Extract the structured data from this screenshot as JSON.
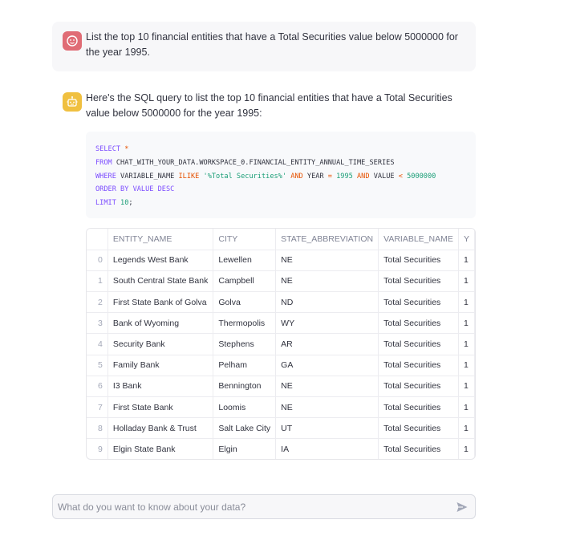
{
  "chat": {
    "user_message": "List the top 10 financial entities that have a Total Securities value below 5000000 for the year 1995.",
    "assistant_message": "Here's the SQL query to list the top 10 financial entities that have a Total Securities value below 5000000 for the year 1995:",
    "sql": {
      "line1_kw": "SELECT",
      "line1_rest": " *",
      "line2_kw": "FROM",
      "line2_rest": " CHAT_WITH_YOUR_DATA.WORKSPACE_0.FINANCIAL_ENTITY_ANNUAL_TIME_SERIES",
      "line3_kw": "WHERE",
      "line3_a": " VARIABLE_NAME ",
      "line3_ilike": "ILIKE",
      "line3_str": " '%Total Securities%' ",
      "line3_and1": "AND",
      "line3_b": " YEAR ",
      "line3_eq": "=",
      "line3_year": " 1995 ",
      "line3_and2": "AND",
      "line3_c": " VALUE ",
      "line3_lt": "<",
      "line3_val": " 5000000",
      "line4_kw": "ORDER BY",
      "line4_rest": " VALUE DESC",
      "line5_kw": "LIMIT",
      "line5_num": " 10",
      "line5_end": ";"
    }
  },
  "table": {
    "columns": [
      "",
      "ENTITY_NAME",
      "CITY",
      "STATE_ABBREVIATION",
      "VARIABLE_NAME",
      "Y"
    ],
    "rows": [
      [
        "0",
        "Legends West Bank",
        "Lewellen",
        "NE",
        "Total Securities",
        "1"
      ],
      [
        "1",
        "South Central State Bank",
        "Campbell",
        "NE",
        "Total Securities",
        "1"
      ],
      [
        "2",
        "First State Bank of Golva",
        "Golva",
        "ND",
        "Total Securities",
        "1"
      ],
      [
        "3",
        "Bank of Wyoming",
        "Thermopolis",
        "WY",
        "Total Securities",
        "1"
      ],
      [
        "4",
        "Security Bank",
        "Stephens",
        "AR",
        "Total Securities",
        "1"
      ],
      [
        "5",
        "Family Bank",
        "Pelham",
        "GA",
        "Total Securities",
        "1"
      ],
      [
        "6",
        "I3 Bank",
        "Bennington",
        "NE",
        "Total Securities",
        "1"
      ],
      [
        "7",
        "First State Bank",
        "Loomis",
        "NE",
        "Total Securities",
        "1"
      ],
      [
        "8",
        "Holladay Bank & Trust",
        "Salt Lake City",
        "UT",
        "Total Securities",
        "1"
      ],
      [
        "9",
        "Elgin State Bank",
        "Elgin",
        "IA",
        "Total Securities",
        "1"
      ]
    ]
  },
  "input": {
    "placeholder": "What do you want to know about your data?",
    "value": ""
  },
  "icons": {
    "user_avatar": "user-face-icon",
    "assistant_avatar": "robot-icon",
    "send": "send-arrow-icon"
  },
  "colors": {
    "user_avatar_bg": "#e06c75",
    "assistant_avatar_bg": "#f0c040",
    "keyword": "#7c4dff",
    "string": "#1b9e77",
    "operator": "#e65100"
  }
}
